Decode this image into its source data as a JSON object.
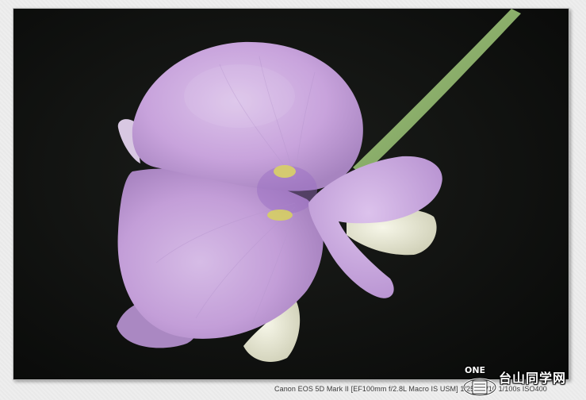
{
  "photo": {
    "subject": "flower-macro",
    "colors": {
      "background": "#0e0f0e",
      "petal": "#c9a6dc",
      "petal_light": "#e7d6ef",
      "petal_vein": "#a57cc6",
      "yellow_spot": "#d9d266",
      "stem": "#8fb46a",
      "white_petal": "#eeeedc"
    }
  },
  "exif_caption": "Canon EOS 5D Mark II [EF100mm f/2.8L Macro IS USM] 1/250s f/10 1/100s ISO400",
  "watermark": {
    "brand": "ONE",
    "site_name": "台山同学网"
  }
}
